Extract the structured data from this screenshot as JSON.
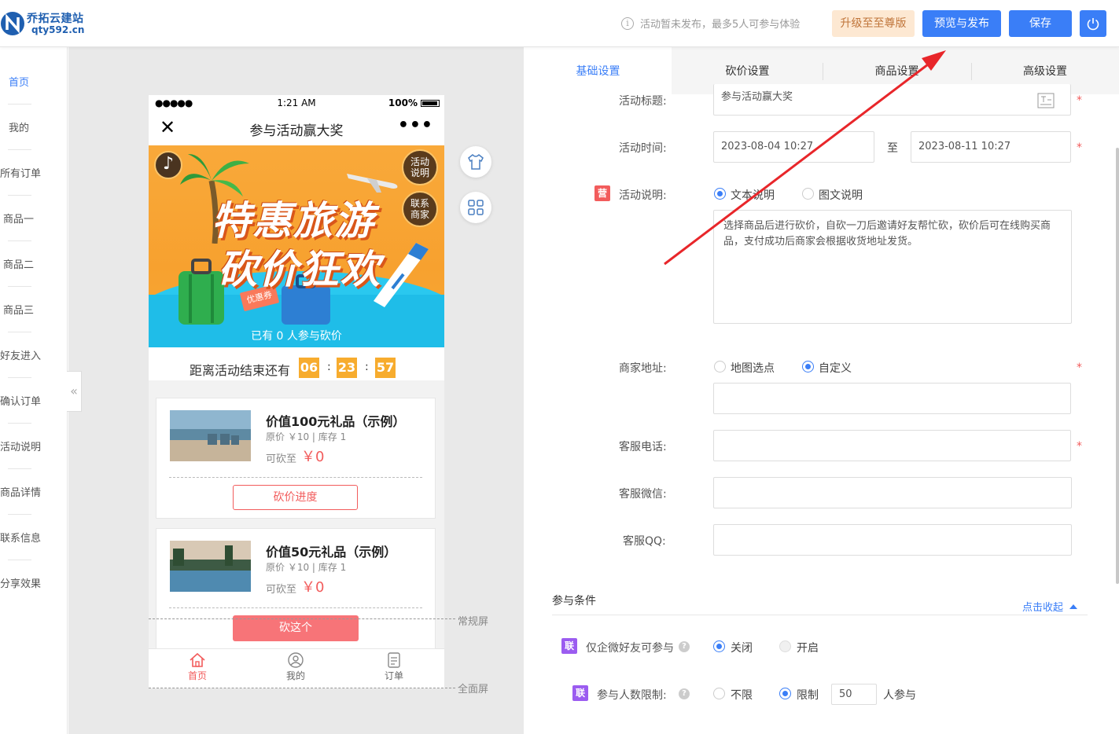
{
  "header": {
    "logo_name": "乔拓云建站",
    "logo_url": "qty592.cn",
    "notice": "活动暂未发布，最多5人可参与体验",
    "upgrade_label": "升级至至尊版",
    "preview_label": "预览与发布",
    "save_label": "保存"
  },
  "left_nav": {
    "items": [
      "首页",
      "我的",
      "所有订单",
      "商品一",
      "商品二",
      "商品三",
      "好友进入",
      "确认订单",
      "活动说明",
      "商品详情",
      "联系信息",
      "分享效果"
    ],
    "active_index": 0,
    "collapse_glyph": "«"
  },
  "phone": {
    "status": {
      "signal": "●●●●●",
      "time": "1:21 AM",
      "battery": "100%"
    },
    "title": "参与活动赢大奖",
    "close_glyph": "✕",
    "more_glyph": "•••",
    "banner": {
      "line1": "特惠旅游",
      "line2": "砍价狂欢",
      "joined": "已有 0 人参与砍价",
      "badge_rules": [
        "活动",
        "说明"
      ],
      "badge_contact": [
        "联系",
        "商家"
      ],
      "coupon": "优惠券",
      "music_glyph": "♪"
    },
    "countdown": {
      "label": "距离活动结束还有",
      "h": "06",
      "m": "23",
      "s": "57",
      "sep": ":"
    },
    "products": [
      {
        "name": "价值100元礼品（示例）",
        "meta": "原价 ￥10 | 库存 1",
        "price_label": "可砍至",
        "price": "￥0",
        "button": "砍价进度"
      },
      {
        "name": "价值50元礼品（示例）",
        "meta": "原价 ￥10 | 库存 1",
        "price_label": "可砍至",
        "price": "￥0",
        "button": "砍这个"
      }
    ],
    "tabs": [
      {
        "label": "首页",
        "active": true
      },
      {
        "label": "我的",
        "active": false
      },
      {
        "label": "订单",
        "active": false
      }
    ]
  },
  "screen_markers": {
    "normal": "常规屏",
    "full": "全面屏"
  },
  "settings": {
    "tabs": [
      "基础设置",
      "砍价设置",
      "商品设置",
      "高级设置"
    ],
    "active_tab": 0,
    "title_label": "活动标题:",
    "title_value": "参与活动赢大奖",
    "time_label": "活动时间:",
    "time_start": "2023-08-04 10:27",
    "time_sep": "至",
    "time_end": "2023-08-11 10:27",
    "desc_tag": "营",
    "desc_label": "活动说明:",
    "desc_opt_text": "文本说明",
    "desc_opt_rich": "图文说明",
    "desc_value": "选择商品后进行砍价，自砍一刀后邀请好友帮忙砍，砍价后可在线购买商品，支付成功后商家会根据收货地址发货。",
    "addr_label": "商家地址:",
    "addr_opt_map": "地图选点",
    "addr_opt_custom": "自定义",
    "phone_label": "客服电话:",
    "wechat_label": "客服微信:",
    "qq_label": "客服QQ:",
    "required_mark": "*",
    "conditions_title": "参与条件",
    "collapse_label": "点击收起",
    "friend_tag": "联",
    "friend_label": "仅企微好友可参与",
    "friend_off": "关闭",
    "friend_on": "开启",
    "limit_tag": "联",
    "limit_label": "参与人数限制:",
    "limit_unlimited": "不限",
    "limit_limited": "限制",
    "limit_value": "50",
    "limit_suffix": "人参与",
    "help_glyph": "?"
  },
  "colors": {
    "primary": "#3a7ef7",
    "danger": "#f25c5c",
    "countdown": "#f7ac2e",
    "upgrade_bg": "#fde8d2",
    "arrow": "#e8262a"
  }
}
